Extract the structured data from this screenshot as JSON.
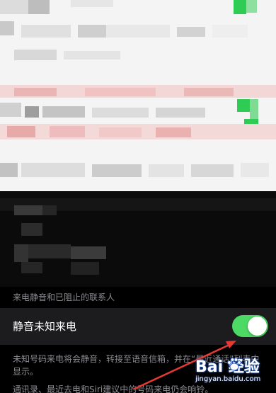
{
  "settings": {
    "section_header": "来电静音和已阻止的联系人",
    "silence_row": {
      "label": "静音未知来电",
      "toggle_state": "on",
      "toggle_color": "#4cd964"
    },
    "footer_text": "未知号码来电将会静音，转接至语音信箱，并在“最近通话”列表中显示。",
    "footer_text_cut": "通讯录、最近去电和Siri建议中的号码来电仍会响铃。"
  },
  "watermark": {
    "logo_text": "Bai  经验",
    "url": "jingyan.baidu.com"
  },
  "colors": {
    "row_background": "#1c1c1e",
    "secondary_text": "#8d8d93",
    "annotation_arrow": "#e53935"
  }
}
